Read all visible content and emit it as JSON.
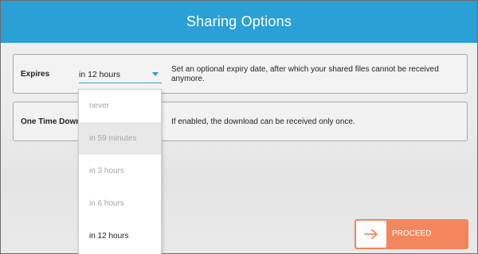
{
  "header": {
    "title": "Sharing Options"
  },
  "expires": {
    "label": "Expires",
    "selected_value": "in 12 hours",
    "description": "Set an optional expiry date, after which your shared files cannot be received anymore.",
    "options": [
      "never",
      "in 59 minutes",
      "in 3 hours",
      "in 6 hours",
      "in 12 hours"
    ],
    "hovered_option": "in 59 minutes"
  },
  "one_time_download": {
    "label": "One Time Download",
    "description": "If enabled, the download can be received only once."
  },
  "actions": {
    "proceed_label": "PROCEED",
    "proceed_icon": "arrow-right-icon"
  },
  "colors": {
    "header": "#2aa0d6",
    "accent": "#2aa0d6",
    "proceed": "#f3865c"
  }
}
